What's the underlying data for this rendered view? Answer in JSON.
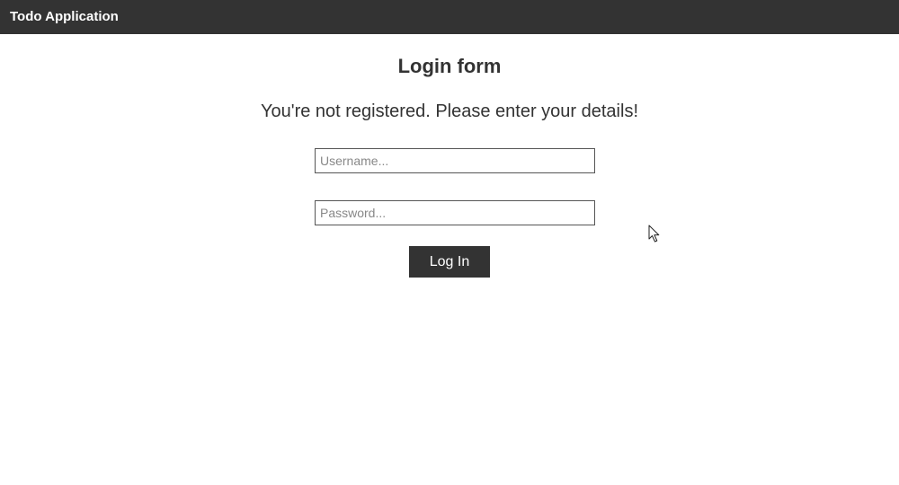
{
  "navbar": {
    "brand": "Todo Application"
  },
  "login": {
    "title": "Login form",
    "message": "You're not registered. Please enter your details!",
    "username_placeholder": "Username...",
    "password_placeholder": "Password...",
    "submit_label": "Log In"
  },
  "colors": {
    "navbar_bg": "#333333",
    "button_bg": "#333333",
    "text": "#333333"
  },
  "icons": {
    "cursor": "mouse-pointer-icon"
  }
}
